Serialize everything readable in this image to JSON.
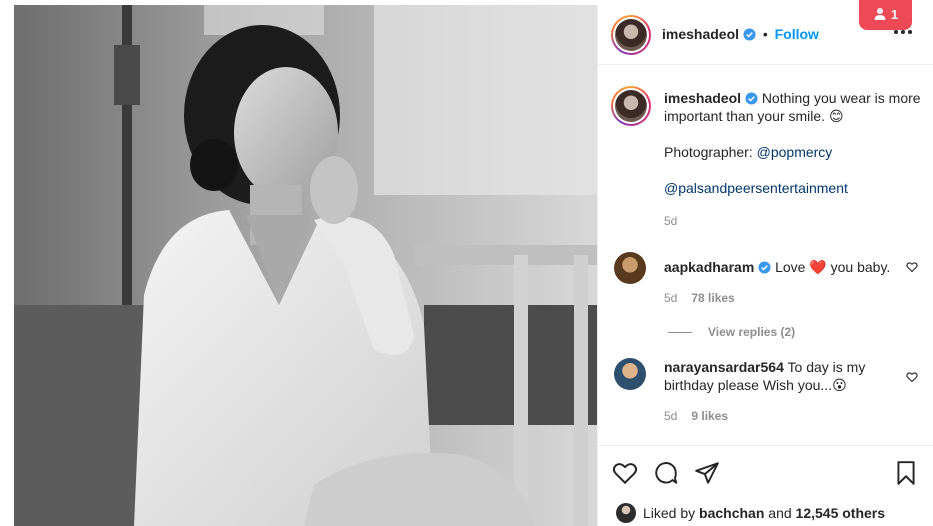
{
  "notification": {
    "count": "1",
    "icon": "person-icon"
  },
  "post": {
    "author": "imeshadeol",
    "follow_label": "Follow",
    "dot": "•",
    "caption_text": "Nothing you wear is more important than your smile. 😊",
    "photographer_label": "Photographer:",
    "photographer_handle": "@popmercy",
    "mention": "@palsandpeersentertainment",
    "age": "5d"
  },
  "comments": [
    {
      "user": "aapkadharam",
      "verified": true,
      "text_before": "Love",
      "emoji": "❤️",
      "text_after": "you baby.",
      "age": "5d",
      "likes": "78 likes",
      "view_replies": "View replies (2)"
    },
    {
      "user": "narayansardar564",
      "verified": false,
      "text": "To day is my birthday please Wish you...😮",
      "age": "5d",
      "likes": "9 likes"
    }
  ],
  "likes_summary": {
    "prefix": "Liked by",
    "user": "bachchan",
    "and": "and",
    "count": "12,545 others"
  },
  "colors": {
    "accent": "#0095f6",
    "badge": "#ed4956",
    "verified": "#3897f0"
  }
}
